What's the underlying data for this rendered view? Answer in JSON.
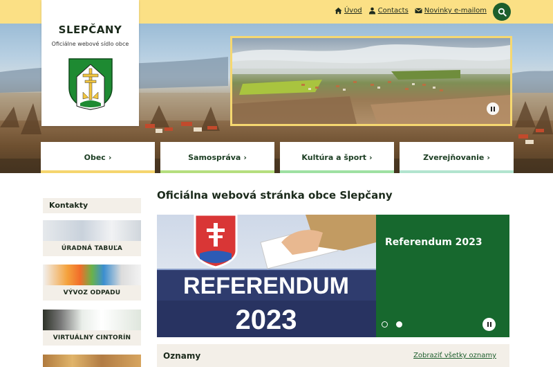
{
  "topbar": {
    "links": [
      {
        "label": "Úvod",
        "icon": "home-icon"
      },
      {
        "label": "Contacts",
        "icon": "person-icon"
      },
      {
        "label": "Novinky e-mailom",
        "icon": "envelope-icon"
      }
    ],
    "search_icon": "search-icon"
  },
  "header": {
    "site_name": "SLEPČANY",
    "subtitle": "Oficiálne webové sídlo obce",
    "crest_icon": "coat-of-arms-icon"
  },
  "nav": [
    {
      "label": "Obec"
    },
    {
      "label": "Samospráva"
    },
    {
      "label": "Kultúra a šport"
    },
    {
      "label": "Zverejňovanie"
    }
  ],
  "sidebar": {
    "title": "Kontakty",
    "tiles": [
      {
        "label": "ÚRADNÁ TABUĽA"
      },
      {
        "label": "VÝVOZ ODPADU"
      },
      {
        "label": "VIRTUÁLNY CINTORÍN"
      },
      {
        "label": ""
      }
    ]
  },
  "main": {
    "page_title": "Oficiálna webová stránka obce Slepčany",
    "slider": {
      "image_line1": "REFERENDUM",
      "image_line2": "2023",
      "title": "Referendum 2023",
      "slide_count": 2,
      "active_slide": 2
    },
    "news": {
      "title": "Oznamy",
      "all_link": "Zobraziť všetky oznamy"
    }
  },
  "colors": {
    "topbar": "#fbe085",
    "brand_green": "#1d5e2c",
    "slide_panel": "#17682e",
    "panel_beige": "#f3efe8"
  }
}
